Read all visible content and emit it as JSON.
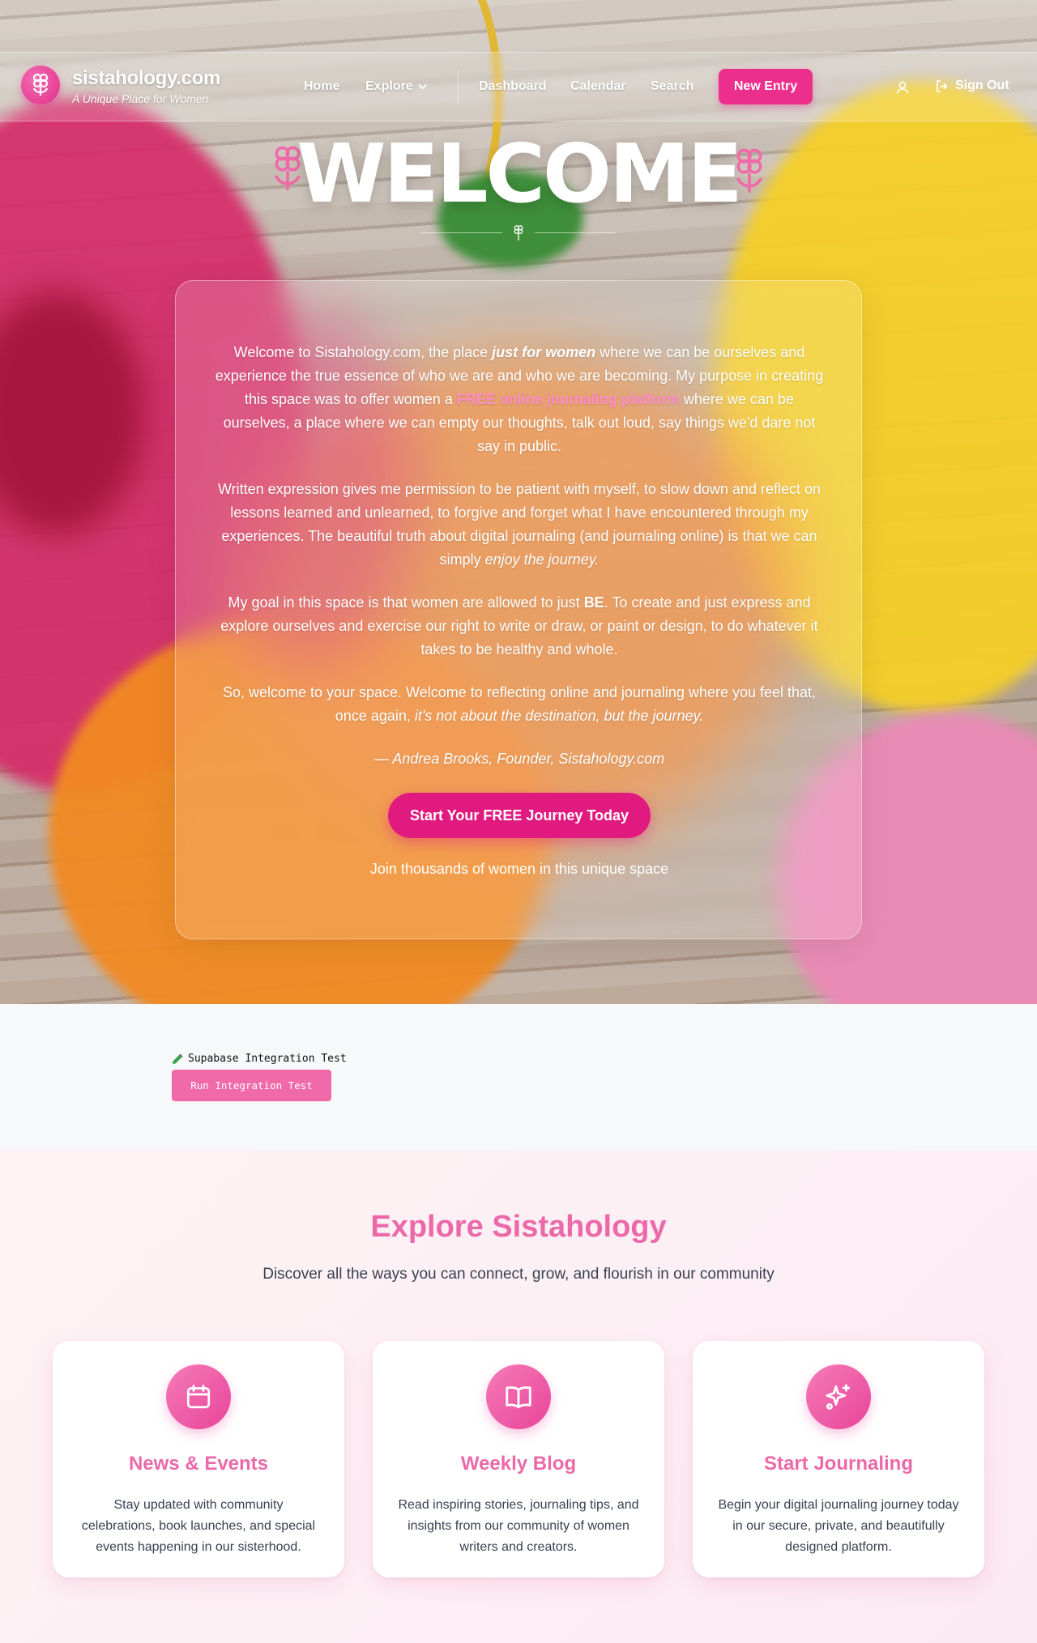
{
  "nav": {
    "brand_name": "sistahology.com",
    "brand_tagline": "A Unique Place for Women",
    "links": [
      "Home",
      "Explore",
      "Dashboard",
      "Calendar",
      "Search"
    ],
    "new_entry": "New Entry",
    "sign_out": "Sign Out"
  },
  "hero": {
    "title": "WELCOME",
    "p1_a": "Welcome to Sistahology.com, the place ",
    "p1_b": "just for women",
    "p1_c": " where we can be ourselves and experience the true essence of who we are and who we are becoming. My purpose in creating this space was to offer women a ",
    "p1_d": "FREE online journaling platform",
    "p1_e": " where we can be ourselves, a place where we can empty our thoughts, talk out loud, say things we'd dare not say in public.",
    "p2_a": "Written expression gives me permission to be patient with myself, to slow down and reflect on lessons learned and unlearned, to forgive and forget what I have encountered through my experiences. The beautiful truth about digital journaling (and journaling online) is that we can simply ",
    "p2_b": "enjoy the journey.",
    "p3_a": "My goal in this space is that women are allowed to just ",
    "p3_b": "BE",
    "p3_c": ". To create and just express and explore ourselves and exercise our right to write or draw, or paint or design, to do whatever it takes to be healthy and whole.",
    "p4_a": "So, welcome to your space. Welcome to reflecting online and journaling where you feel that, once again, ",
    "p4_b": "it's not about the destination, but the journey.",
    "signature": "— Andrea Brooks, Founder, Sistahology.com",
    "cta": "Start Your FREE Journey Today",
    "join": "Join thousands of women in this unique space"
  },
  "test": {
    "label": "Supabase Integration Test",
    "button": "Run Integration Test"
  },
  "explore": {
    "title": "Explore Sistahology",
    "subtitle": "Discover all the ways you can connect, grow, and flourish in our community",
    "cards": [
      {
        "icon": "calendar-icon",
        "title": "News & Events",
        "desc": "Stay updated with community celebrations, book launches, and special events happening in our sisterhood."
      },
      {
        "icon": "book-open-icon",
        "title": "Weekly Blog",
        "desc": "Read inspiring stories, journaling tips, and insights from our community of women writers and creators."
      },
      {
        "icon": "sparkles-icon",
        "title": "Start Journaling",
        "desc": "Begin your digital journaling journey today in our secure, private, and beautifully designed platform."
      }
    ]
  },
  "colors": {
    "accent": "#ec2f8c",
    "pink_heading": "#ec69a9",
    "text_dark": "#374151"
  }
}
